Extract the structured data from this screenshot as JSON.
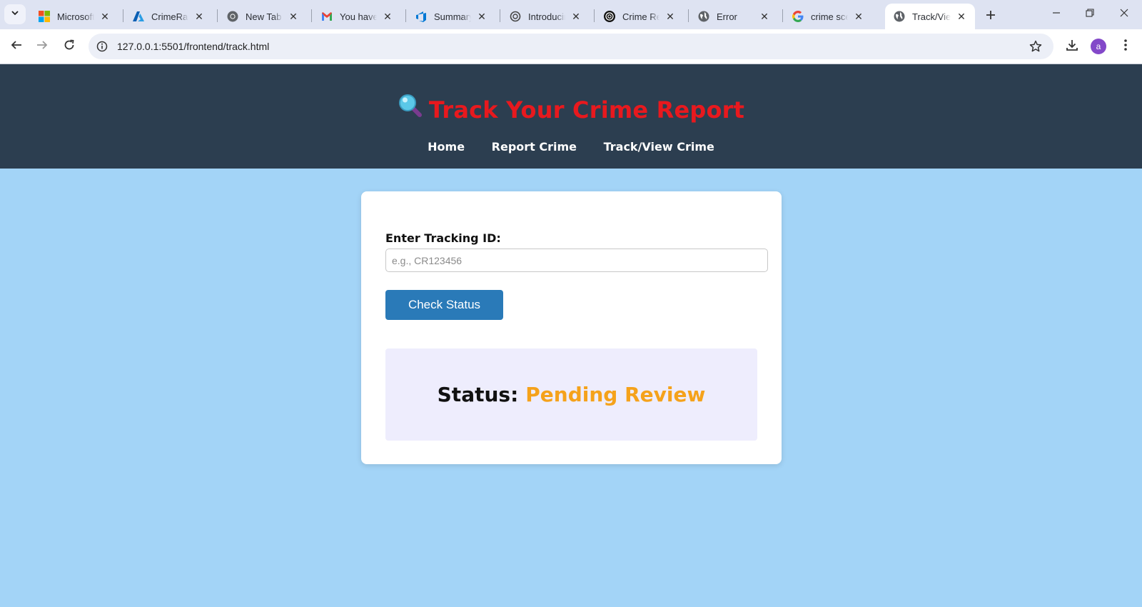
{
  "browser": {
    "tabs": [
      {
        "title": "Microsoft Azure",
        "icon": "microsoft-logo-icon"
      },
      {
        "title": "CrimeRate",
        "icon": "azure-logo-icon"
      },
      {
        "title": "New Tab",
        "icon": "chrome-icon"
      },
      {
        "title": "You have been",
        "icon": "gmail-icon"
      },
      {
        "title": "Summary",
        "icon": "azure-devops-icon"
      },
      {
        "title": "Introducing",
        "icon": "openai-icon"
      },
      {
        "title": "Crime Report",
        "icon": "openai-icon"
      },
      {
        "title": "Error",
        "icon": "globe-icon"
      },
      {
        "title": "crime scene",
        "icon": "google-icon"
      },
      {
        "title": "Track/View",
        "icon": "globe-icon",
        "active": true
      }
    ],
    "url": "127.0.0.1:5501/frontend/track.html",
    "profile_initial": "a"
  },
  "page": {
    "title": "Track Your Crime Report",
    "title_icon": "magnifying-glass-icon",
    "nav": [
      "Home",
      "Report Crime",
      "Track/View Crime"
    ],
    "form": {
      "label": "Enter Tracking ID:",
      "placeholder": "e.g., CR123456",
      "value": "",
      "button": "Check Status"
    },
    "status": {
      "label": "Status:",
      "value": "Pending Review"
    }
  },
  "colors": {
    "header_bg": "#2c3e50",
    "title": "#e8191e",
    "page_bg": "#a3d4f7",
    "button": "#2a7ab8",
    "status_value": "#f5a21b",
    "status_box": "#eeedfd"
  }
}
